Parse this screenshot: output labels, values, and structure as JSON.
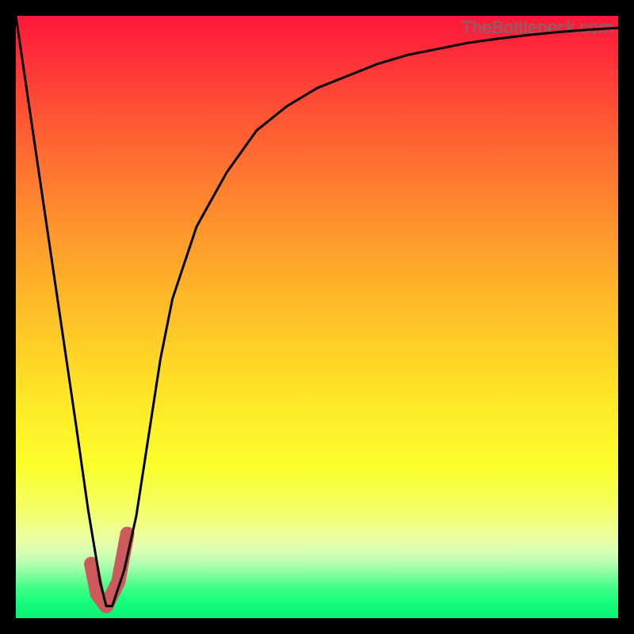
{
  "watermark": "TheBottleneck.com",
  "colors": {
    "frame": "#000000",
    "curve": "#000000",
    "accent": "#cc5a5d"
  },
  "chart_data": {
    "type": "line",
    "title": "",
    "xlabel": "",
    "ylabel": "",
    "xlim": [
      0,
      100
    ],
    "ylim": [
      0,
      100
    ],
    "grid": false,
    "legend": "none",
    "annotations": [
      "TheBottleneck.com"
    ],
    "series": [
      {
        "name": "bottleneck-curve",
        "x": [
          0,
          5,
          10,
          12,
          14,
          15,
          16,
          18,
          20,
          22,
          24,
          26,
          30,
          35,
          40,
          45,
          50,
          55,
          60,
          65,
          70,
          75,
          80,
          85,
          90,
          95,
          100
        ],
        "values": [
          100,
          66,
          32,
          18,
          6,
          2,
          2,
          8,
          17,
          30,
          43,
          53,
          65,
          74,
          81,
          85,
          88,
          90,
          92,
          93.5,
          94.5,
          95.5,
          96.2,
          96.8,
          97.3,
          97.7,
          98
        ]
      },
      {
        "name": "accent-highlight",
        "x": [
          12.5,
          13.5,
          15,
          17,
          18.5
        ],
        "values": [
          9,
          4,
          2,
          6,
          14
        ]
      }
    ],
    "notes": "Gradient background from red (top) through orange/yellow to green (bottom). Single V-shaped black curve with minimum near x≈15, rising asymptotically toward ~98% at the right. Short thick pink/red segment overlays the curve near the trough."
  }
}
